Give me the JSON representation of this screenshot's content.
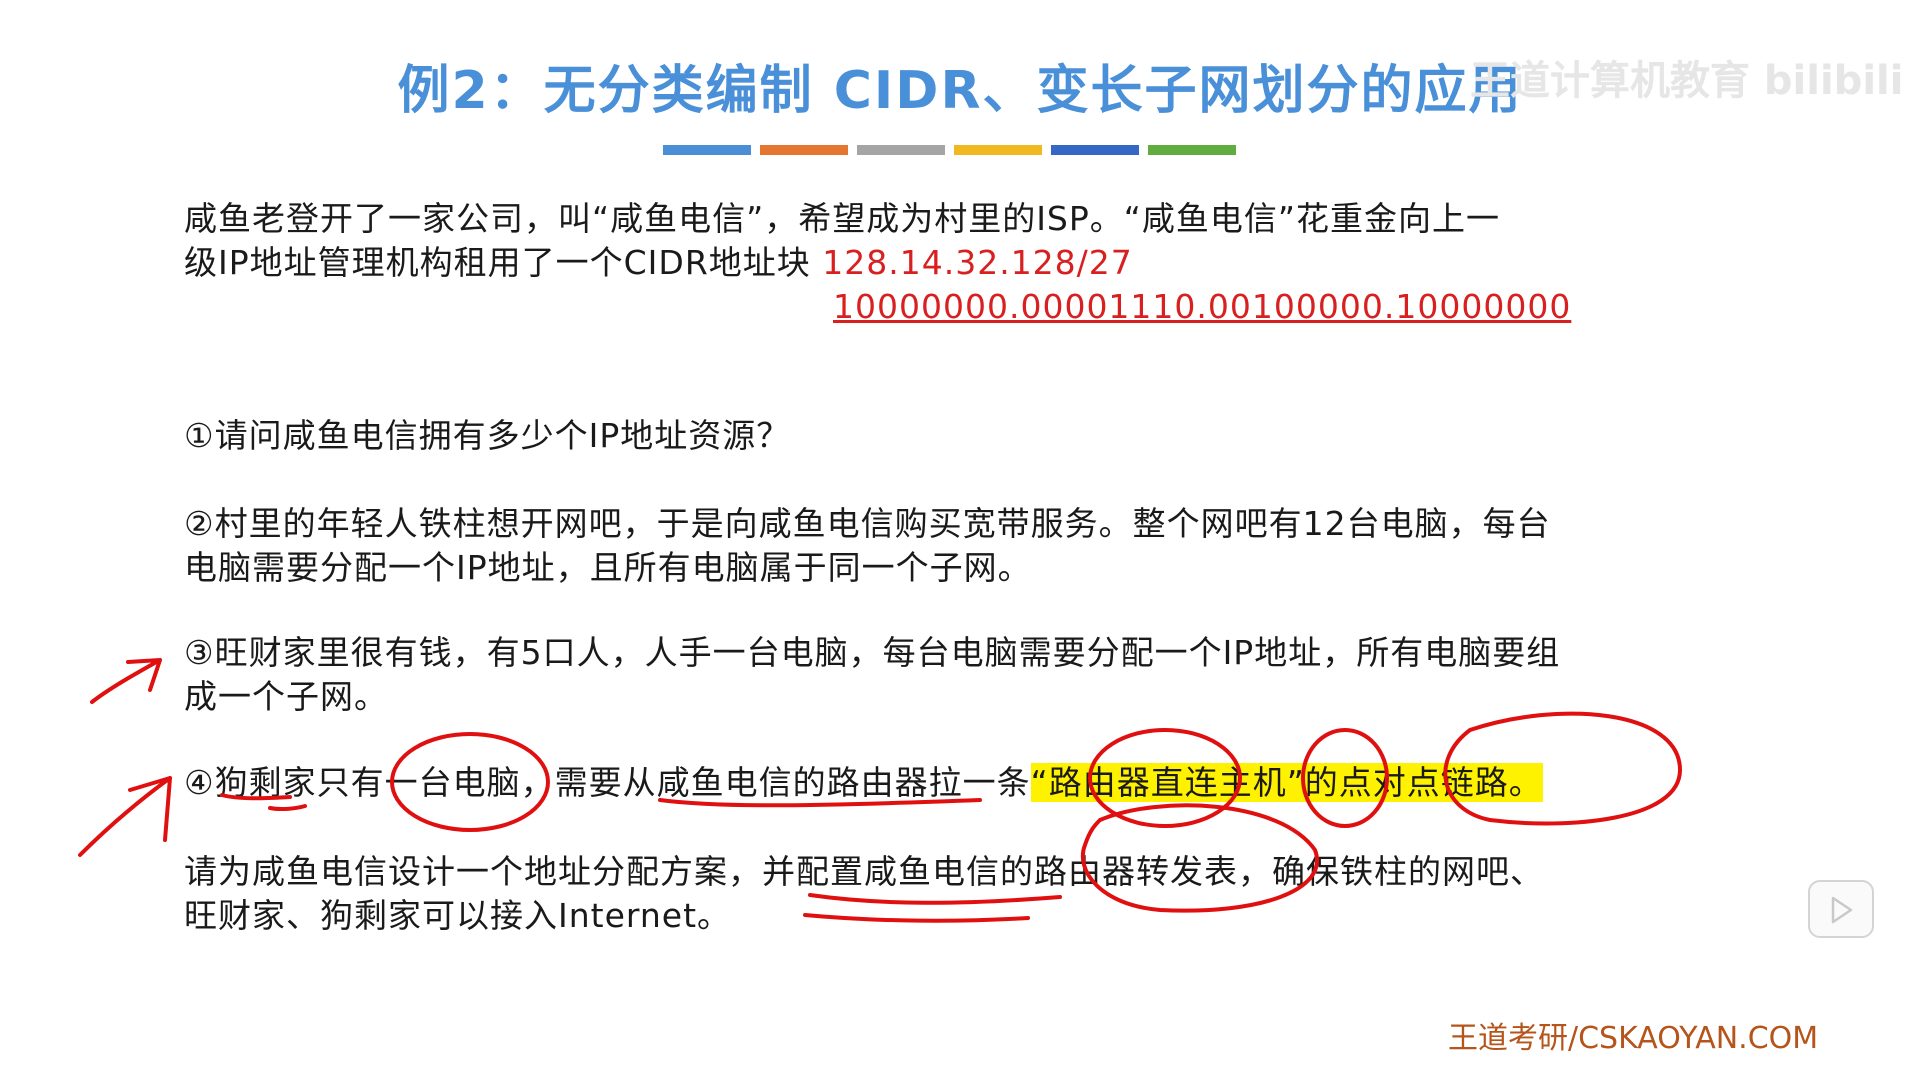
{
  "slide": {
    "title": "例2：无分类编制 CIDR、变长子网划分的应用",
    "title_color": "#4a90d9",
    "color_bar": [
      "#4a8fd6",
      "#e5762f",
      "#a5a5a5",
      "#f2b820",
      "#3567c4",
      "#5fad3e"
    ],
    "intro": {
      "line1": "咸鱼老登开了一家公司，叫“咸鱼电信”，希望成为村里的ISP。“咸鱼电信”花重金向上一",
      "line2_prefix": "级IP地址管理机构租用了一个CIDR地址块 ",
      "cidr_block": "128.14.32.128/27",
      "binary": "10000000.00001110.00100000.10000000"
    },
    "q1": "①请问咸鱼电信拥有多少个IP地址资源？",
    "q2": {
      "line1": "②村里的年轻人铁柱想开网吧，于是向咸鱼电信购买宽带服务。整个网吧有12台电脑，每台",
      "line2": "电脑需要分配一个IP地址，且所有电脑属于同一个子网。"
    },
    "q3": {
      "line1": "③旺财家里很有钱，有5口人，人手一台电脑，每台电脑需要分配一个IP地址，所有电脑要组",
      "line2": "成一个子网。"
    },
    "q4": {
      "prefix": "④狗剩家只有一台电脑，需要从咸鱼电信的路由器拉一条",
      "highlight": "“路由器直连主机”的点对点链路。"
    },
    "task": {
      "line1": "请为咸鱼电信设计一个地址分配方案，并配置咸鱼电信的路由器转发表，确保铁柱的网吧、",
      "line2": "旺财家、狗剩家可以接入Internet。"
    },
    "watermark": "王道计算机教育 bilibili",
    "footer": "王道考研/CSKAOYAN.COM",
    "ink_color": "#e01010",
    "highlight_color": "#fff200"
  }
}
